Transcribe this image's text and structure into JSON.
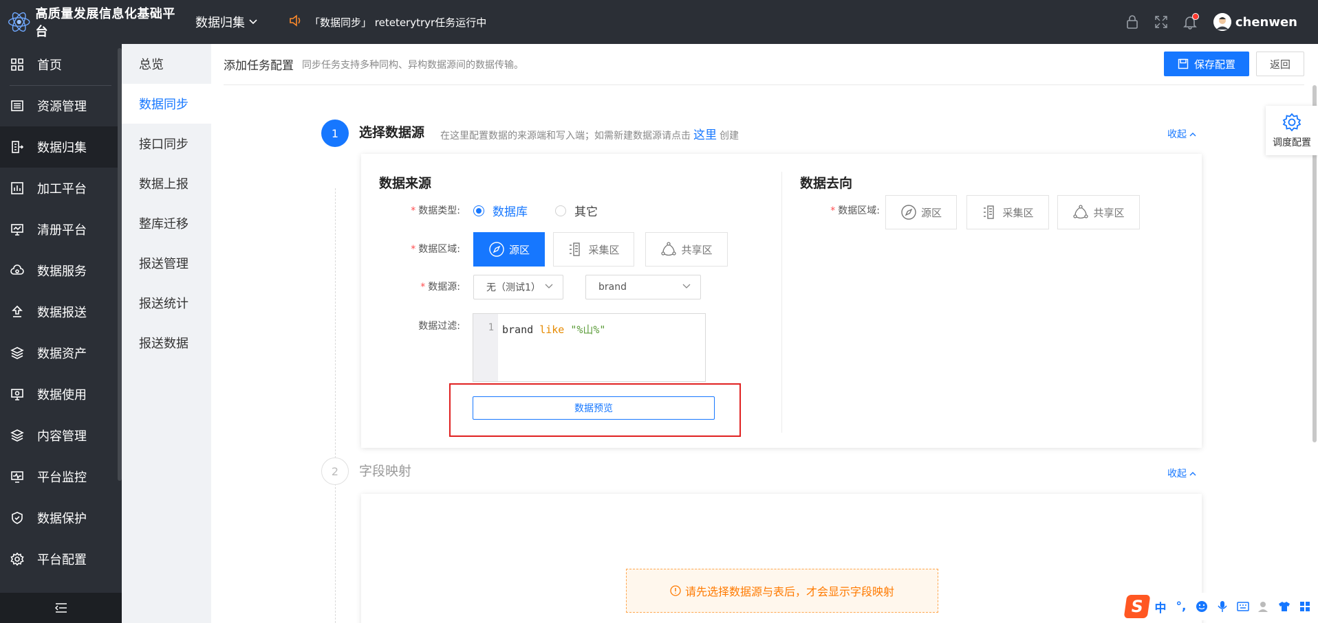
{
  "app": {
    "title": "高质量发展信息化基础平台",
    "module": "数据归集",
    "notice": "「数据同步」 reteterytryr任务运行中",
    "username": "chenwen"
  },
  "sidebar": {
    "items": [
      {
        "label": "首页",
        "icon": "grid-icon"
      },
      {
        "label": "资源管理",
        "icon": "list-icon"
      },
      {
        "label": "数据归集",
        "icon": "collect-icon"
      },
      {
        "label": "加工平台",
        "icon": "chart-icon"
      },
      {
        "label": "清册平台",
        "icon": "monitor-icon"
      },
      {
        "label": "数据服务",
        "icon": "cloud-icon"
      },
      {
        "label": "数据报送",
        "icon": "upload-icon"
      },
      {
        "label": "数据资产",
        "icon": "layers-icon"
      },
      {
        "label": "数据使用",
        "icon": "screen-icon"
      },
      {
        "label": "内容管理",
        "icon": "layers-icon"
      },
      {
        "label": "平台监控",
        "icon": "pulse-icon"
      },
      {
        "label": "数据保护",
        "icon": "shield-icon"
      },
      {
        "label": "平台配置",
        "icon": "gear-icon"
      }
    ],
    "active_index": 2
  },
  "submenu": {
    "items": [
      "总览",
      "数据同步",
      "接口同步",
      "数据上报",
      "整库迁移",
      "报送管理",
      "报送统计",
      "报送数据"
    ],
    "active_index": 1
  },
  "page": {
    "title": "添加任务配置",
    "desc": "同步任务支持多种同构、异构数据源间的数据传输。",
    "save_label": "保存配置",
    "back_label": "返回",
    "schedule_label": "调度配置"
  },
  "step1": {
    "number": "1",
    "title": "选择数据源",
    "desc_before": "在这里配置数据的来源端和写入端；如需新建数据源请点击",
    "desc_link": "这里",
    "desc_after": "创建",
    "collapse": "收起"
  },
  "source": {
    "title": "数据来源",
    "type_label": "数据类型:",
    "type_options": [
      "数据库",
      "其它"
    ],
    "type_selected": 0,
    "zone_label": "数据区域:",
    "zones": [
      "源区",
      "采集区",
      "共享区"
    ],
    "zone_selected": 0,
    "ds_label": "数据源:",
    "ds_value": "无（测试1）",
    "table_value": "brand",
    "filter_label": "数据过滤:",
    "filter_line": "1",
    "filter_code": {
      "field": "brand",
      "op": "like",
      "value": "\"%山%\""
    },
    "preview_label": "数据预览"
  },
  "target": {
    "title": "数据去向",
    "zone_label": "数据区域:",
    "zones": [
      "源区",
      "采集区",
      "共享区"
    ]
  },
  "step2": {
    "number": "2",
    "title": "字段映射",
    "collapse": "收起",
    "warning": "请先选择数据源与表后，才会显示字段映射"
  },
  "ime": {
    "lang": "中",
    "punct": "°,"
  },
  "colors": {
    "primary": "#1677ff",
    "dark": "#2b2f36",
    "warning": "#ff7a00",
    "highlight": "#e02020"
  }
}
